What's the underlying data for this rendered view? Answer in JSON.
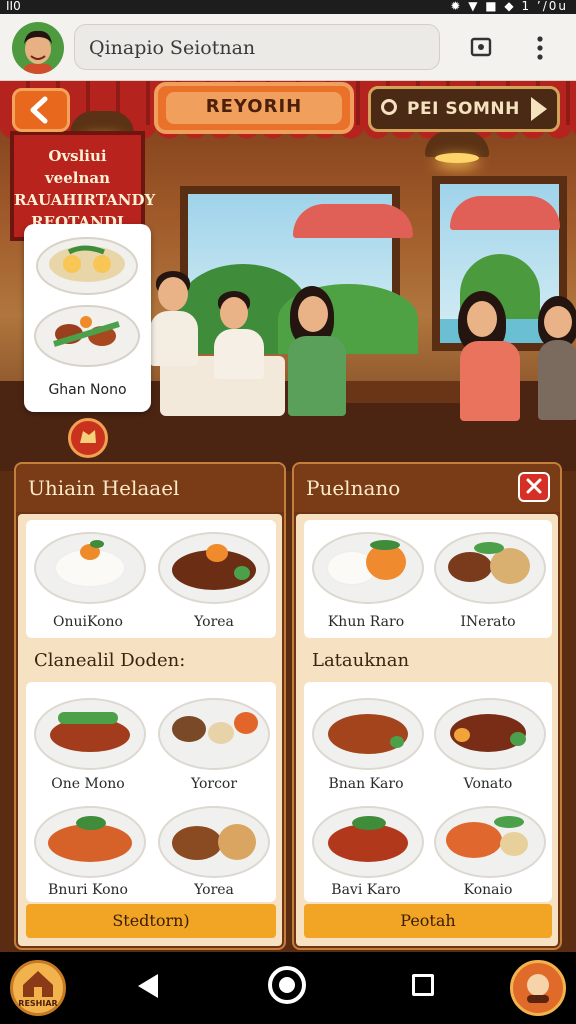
{
  "status_bar": {
    "left": "II0",
    "right": "✹ ▼ ■ ◆ 1 ’/0u"
  },
  "browser": {
    "url_text": "Qinapio Seiotnan",
    "icons": [
      "avatar-icon",
      "tabs-icon",
      "more-vert-icon"
    ]
  },
  "scene": {
    "sign_text": "Ovsliui veelnan RAUAHIRTANDY REOTANDI",
    "back_icon": "chevron-left-icon",
    "primary_button": "REYORIH",
    "secondary_button": "PEI SOMNH",
    "float_card_caption": "Ghan Nono"
  },
  "left_panel": {
    "title": "Uhiain Helaael",
    "top_items": [
      {
        "label": "OnuiKono"
      },
      {
        "label": "Yorea"
      }
    ],
    "section_title": "Clanealil Doden:",
    "items": [
      {
        "label": "One Mono"
      },
      {
        "label": "Yorcor"
      },
      {
        "label": "Bnuri Kono"
      },
      {
        "label": "Yorea"
      }
    ],
    "footer_button": "Stedtorn)"
  },
  "right_panel": {
    "title": "Puelnano",
    "close_icon": "close-icon",
    "top_items": [
      {
        "label": "Khun Raro"
      },
      {
        "label": "INerato"
      }
    ],
    "section_title": "Latauknan",
    "items": [
      {
        "label": "Bnan Karo"
      },
      {
        "label": "Vonato"
      },
      {
        "label": "Bavi Karo"
      },
      {
        "label": "Konaio"
      }
    ],
    "footer_button": "Peotah"
  },
  "navbar": {
    "home_label": "RESHIAR",
    "icons": [
      "home-icon",
      "back-icon",
      "home-circle-icon",
      "recent-apps-icon",
      "profile-icon"
    ]
  },
  "colors": {
    "accent_orange": "#e9712a",
    "panel_brown": "#6e3514",
    "cream": "#f6e2c3",
    "close_red": "#d62f26",
    "button_yellow": "#f2a424"
  }
}
